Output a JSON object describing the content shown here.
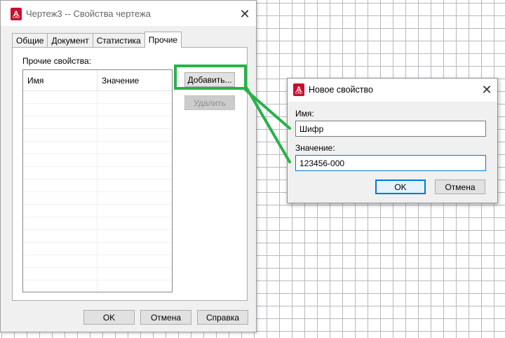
{
  "main_dialog": {
    "title": "Чертеж3 -- Свойства чертежа",
    "close_glyph": "✕",
    "tabs": [
      {
        "label": "Общие",
        "active": false
      },
      {
        "label": "Документ",
        "active": false
      },
      {
        "label": "Статистика",
        "active": false
      },
      {
        "label": "Прочие",
        "active": true
      }
    ],
    "props_label": "Прочие свойства:",
    "columns": {
      "name": "Имя",
      "value": "Значение"
    },
    "add_button": "Добавить...",
    "delete_button": "Удалить",
    "ok_button": "OK",
    "cancel_button": "Отмена",
    "help_button": "Справка"
  },
  "new_property_dialog": {
    "title": "Новое свойство",
    "close_glyph": "✕",
    "name_label": "Имя:",
    "name_value": "Шифр",
    "value_label": "Значение:",
    "value_value": "123456-000",
    "ok_button": "OK",
    "cancel_button": "Отмена"
  },
  "app_icon": {
    "name": "autocad-icon",
    "letter": "A",
    "sub": "CAD",
    "color": "#c8102e"
  },
  "annotation": {
    "color": "#28b24b"
  }
}
